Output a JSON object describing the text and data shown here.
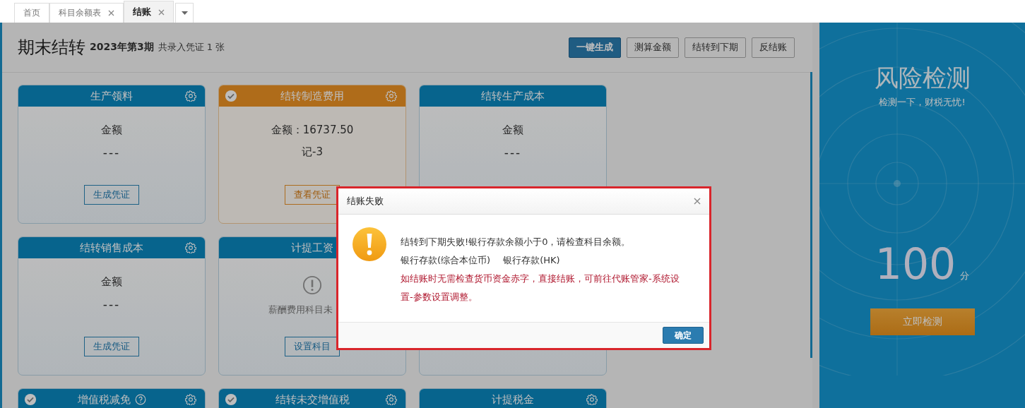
{
  "tabs": [
    {
      "label": "首页",
      "selected": false,
      "closable": false
    },
    {
      "label": "科目余额表",
      "selected": false,
      "closable": true
    },
    {
      "label": "结账",
      "selected": true,
      "closable": true
    }
  ],
  "header": {
    "title": "期末结转",
    "period": "2023年第3期",
    "summary": "共录入凭证 1 张"
  },
  "toolbar": [
    {
      "label": "一键生成",
      "primary": true
    },
    {
      "label": "测算金额",
      "primary": false
    },
    {
      "label": "结转到下期",
      "primary": false
    },
    {
      "label": "反结账",
      "primary": false
    }
  ],
  "cards": [
    {
      "title": "生产领料",
      "checked": false,
      "generated": false,
      "settings": true,
      "help": false,
      "body": {
        "kind": "amount",
        "label": "金额",
        "value": "---"
      },
      "button": "生成凭证"
    },
    {
      "title": "结转制造费用",
      "checked": true,
      "generated": true,
      "settings": true,
      "help": false,
      "body": {
        "kind": "voucher",
        "amount": "金额：16737.50",
        "voucher": "记-3"
      },
      "button": "查看凭证"
    },
    {
      "title": "结转生产成本",
      "checked": false,
      "generated": false,
      "settings": false,
      "help": false,
      "body": {
        "kind": "amount",
        "label": "金额",
        "value": "---"
      }
    },
    {
      "title": "结转销售成本",
      "checked": false,
      "generated": false,
      "settings": true,
      "help": false,
      "body": {
        "kind": "amount",
        "label": "金额",
        "value": "---"
      },
      "button": "生成凭证"
    },
    {
      "title": "计提工资",
      "checked": false,
      "generated": false,
      "help": false,
      "body": {
        "kind": "warning",
        "message": "薪酬费用科目未"
      },
      "button": "设置科目"
    },
    {
      "generated": false
    },
    {
      "title": "增值税减免",
      "checked": true,
      "generated": false,
      "settings": true,
      "help": true
    },
    {
      "title": "结转未交增值税",
      "checked": true,
      "generated": false,
      "settings": true,
      "help": false
    },
    {
      "title": "计提税金",
      "checked": false,
      "generated": false,
      "settings": true,
      "help": false
    }
  ],
  "risk_panel": {
    "title": "风险检测",
    "subtitle": "检测一下，财税无忧!",
    "score": "100",
    "unit": "分",
    "button": "立即检测"
  },
  "dialog": {
    "title": "结账失败",
    "message": "结转到下期失败!银行存款余额小于0，请检查科目余额。",
    "accounts": [
      "银行存款(综合本位币)",
      "银行存款(HK)"
    ],
    "note": "如结账时无需检查货币资金赤字，直接结账，可前往代账管家-系统设置-参数设置调整。",
    "ok": "确定"
  }
}
